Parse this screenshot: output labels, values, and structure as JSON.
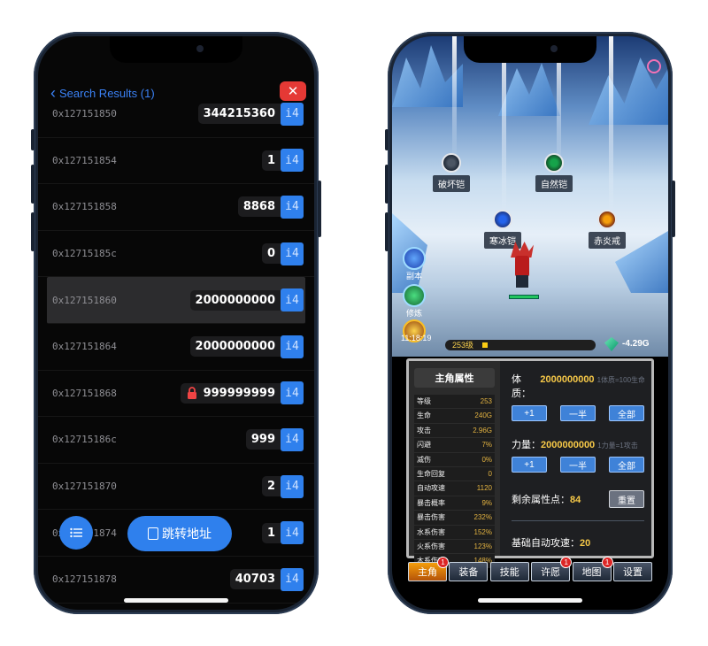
{
  "left": {
    "nav": {
      "back_label": "Search Results (1)",
      "close_icon": "✕"
    },
    "rows": [
      {
        "addr": "0x127151850",
        "value": "344215360",
        "locked": false
      },
      {
        "addr": "0x127151854",
        "value": "1",
        "locked": false
      },
      {
        "addr": "0x127151858",
        "value": "8868",
        "locked": false
      },
      {
        "addr": "0x12715185c",
        "value": "0",
        "locked": false
      },
      {
        "addr": "0x127151860",
        "value": "2000000000",
        "locked": false
      },
      {
        "addr": "0x127151864",
        "value": "2000000000",
        "locked": false
      },
      {
        "addr": "0x127151868",
        "value": "999999999",
        "locked": true
      },
      {
        "addr": "0x12715186c",
        "value": "999",
        "locked": false
      },
      {
        "addr": "0x127151870",
        "value": "2",
        "locked": false
      },
      {
        "addr": "0x127151874",
        "value": "1",
        "locked": false
      },
      {
        "addr": "0x127151878",
        "value": "40703",
        "locked": false
      }
    ],
    "type_badge": "i4",
    "jump_label": "跳转地址"
  },
  "right": {
    "armors": {
      "destroy": "破坏铠",
      "nature": "自然铠",
      "ice": "寒冰铠",
      "flame": "赤炎戒"
    },
    "side_icons": {
      "dungeon": "副本",
      "train": "修炼"
    },
    "hud": {
      "time": "11:18:19",
      "level": "253级",
      "level_progress": 0.05,
      "gems": "-4.29G"
    },
    "panel": {
      "title": "主角属性",
      "stats": [
        {
          "k": "等级",
          "v": "253"
        },
        {
          "k": "生命",
          "v": "240G"
        },
        {
          "k": "攻击",
          "v": "2.96G"
        },
        {
          "k": "闪避",
          "v": "7%"
        },
        {
          "k": "减伤",
          "v": "0%"
        },
        {
          "k": "生命回复",
          "v": "0"
        },
        {
          "k": "自动攻速",
          "v": "1120"
        },
        {
          "k": "暴击概率",
          "v": "9%"
        },
        {
          "k": "暴击伤害",
          "v": "232%"
        },
        {
          "k": "水系伤害",
          "v": "152%"
        },
        {
          "k": "火系伤害",
          "v": "123%"
        },
        {
          "k": "木系伤害",
          "v": "148%"
        }
      ],
      "con_label": "体质：",
      "con_value": "2000000000",
      "con_note": "1体质=100生命",
      "str_label": "力量：",
      "str_value": "2000000000",
      "str_note": "1力量=1攻击",
      "btn_plus1": "+1",
      "btn_half": "一半",
      "btn_all": "全部",
      "points_label": "剩余属性点：",
      "points_value": "84",
      "reset": "重置",
      "speed_label": "基础自动攻速：",
      "speed_value": "20"
    },
    "tabs": [
      {
        "label": "主角",
        "badge": "1"
      },
      {
        "label": "装备",
        "badge": ""
      },
      {
        "label": "技能",
        "badge": ""
      },
      {
        "label": "许愿",
        "badge": "1"
      },
      {
        "label": "地图",
        "badge": "1"
      },
      {
        "label": "设置",
        "badge": ""
      }
    ]
  }
}
